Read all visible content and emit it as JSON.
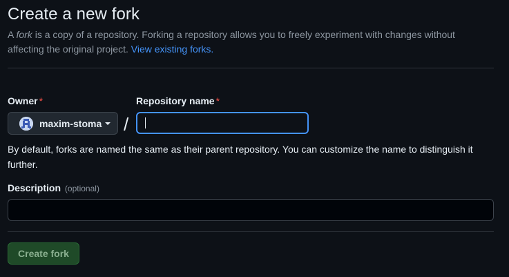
{
  "page": {
    "title": "Create a new fork",
    "description_prefix": "A ",
    "description_fork_word": "fork",
    "description_body": " is a copy of a repository. Forking a repository allows you to freely experiment with changes without affecting the original project. ",
    "view_forks_link": "View existing forks."
  },
  "owner": {
    "label": "Owner",
    "required_mark": "*",
    "selected": "maxim-stoma",
    "avatar_icon": "user-avatar-icon",
    "dropdown_icon": "caret-down-icon"
  },
  "separator": "/",
  "repository": {
    "label": "Repository name",
    "required_mark": "*",
    "value": "",
    "hint": "By default, forks are named the same as their parent repository. You can customize the name to distinguish it further."
  },
  "description_field": {
    "label": "Description",
    "optional_text": "(optional)",
    "value": ""
  },
  "actions": {
    "create_label": "Create fork"
  },
  "colors": {
    "background": "#0d1117",
    "link": "#4493f8",
    "required": "#f85149",
    "focus_border": "#4493f8",
    "create_button_bg": "#1f4a28"
  }
}
